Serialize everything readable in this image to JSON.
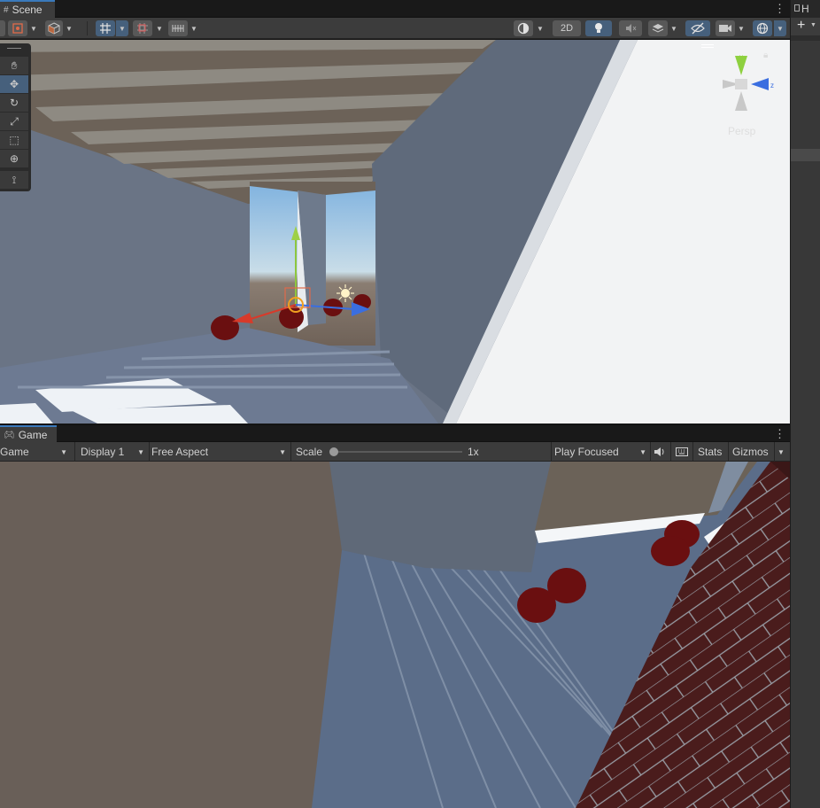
{
  "scene_panel": {
    "tab_label": "Scene",
    "tab_icon": "grid-icon",
    "toolbar": {
      "btn_2d": "2D",
      "items": [
        "gizmo-toggle",
        "draw-mode",
        "snap-grid",
        "incremental-snap",
        "grid-visibility",
        "shading-mode",
        "lighting",
        "audio",
        "effects",
        "visibility",
        "camera",
        "gizmos"
      ]
    },
    "gizmo_label": "Persp",
    "tools": [
      "hand-tool",
      "move-tool",
      "rotate-tool",
      "scale-tool",
      "rect-tool",
      "transform-tool",
      "custom-tool"
    ]
  },
  "game_panel": {
    "tab_label": "Game",
    "tab_icon": "gamepad-icon",
    "view_select": "Game",
    "display_select": "Display 1",
    "aspect_select": "Free Aspect",
    "scale_label": "Scale",
    "scale_value": "1x",
    "play_mode": "Play Focused",
    "stats_label": "Stats",
    "gizmos_label": "Gizmos"
  },
  "right_panel": {
    "tab_label": "H",
    "add_label": "+"
  },
  "colors": {
    "accent": "#3a79bb",
    "toolbar_bg": "#3c3c3c",
    "active_btn": "#46607c",
    "ball": "#6a0f10",
    "wall": "#6b7585",
    "sky": "#9ec6e6"
  }
}
